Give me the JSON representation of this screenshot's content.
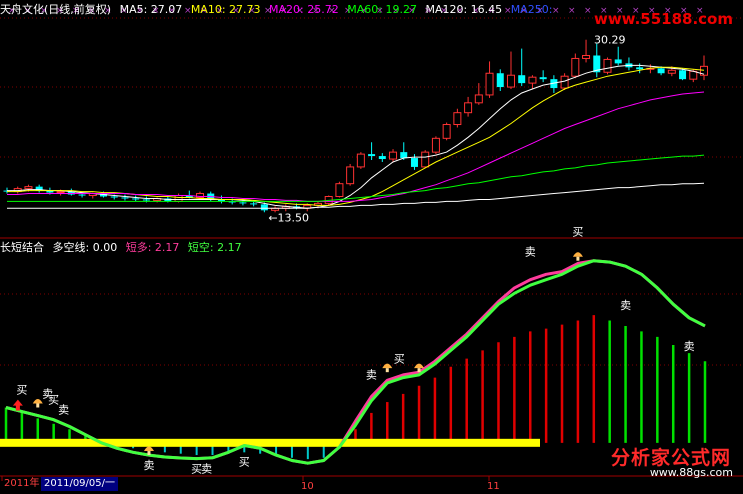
{
  "header_top": {
    "title": "天舟文化(日线,前复权)",
    "ma5": "MA5: 27.07",
    "ma10": "MA10: 27.73",
    "ma20": "MA20: 25.72",
    "ma60": "MA60: 19.27",
    "ma120": "MA120: 16.45",
    "ma250": "MA250: "
  },
  "header_bottom": {
    "title": "长短结合",
    "duokong": "多空线: 0.00",
    "duanduo": "短多: 2.17",
    "duankong": "短空: 2.17"
  },
  "watermark_top": "www.55188.com",
  "watermark_bottom": "分析家公式网",
  "watermark_bottom_url": "www.88gs.com",
  "date_axis": {
    "year_label": "2011年",
    "selected_date": "2011/09/05/一",
    "tick_labels": [
      "10",
      "11"
    ]
  },
  "colors": {
    "ma5": "#ffffff",
    "ma10": "#ffff00",
    "ma20": "#ff00ff",
    "ma60": "#00ff00",
    "ma120": "#ffffff",
    "up": "#ff3232",
    "down": "#00ffff",
    "duanduo": "#ff3c9c",
    "duankong": "#40ff40",
    "zero": "#ffff00"
  },
  "chart_data": [
    {
      "type": "candlestick",
      "title": "天舟文化(日线,前复权)",
      "annotations": [
        {
          "text": "30.29",
          "kind": "high"
        },
        {
          "text": "←13.50",
          "kind": "low"
        }
      ],
      "ylim": [
        11.5,
        33
      ],
      "candles": [
        {
          "o": 15.7,
          "h": 16.0,
          "l": 15.4,
          "c": 15.6
        },
        {
          "o": 15.6,
          "h": 16.1,
          "l": 15.4,
          "c": 15.9
        },
        {
          "o": 15.9,
          "h": 16.3,
          "l": 15.6,
          "c": 16.1
        },
        {
          "o": 16.1,
          "h": 16.3,
          "l": 15.5,
          "c": 15.7
        },
        {
          "o": 15.7,
          "h": 16.0,
          "l": 15.3,
          "c": 15.5
        },
        {
          "o": 15.5,
          "h": 15.8,
          "l": 15.2,
          "c": 15.6
        },
        {
          "o": 15.6,
          "h": 15.9,
          "l": 15.2,
          "c": 15.3
        },
        {
          "o": 15.3,
          "h": 15.6,
          "l": 15.0,
          "c": 15.2
        },
        {
          "o": 15.2,
          "h": 15.5,
          "l": 14.9,
          "c": 15.4
        },
        {
          "o": 15.4,
          "h": 15.6,
          "l": 15.0,
          "c": 15.1
        },
        {
          "o": 15.1,
          "h": 15.3,
          "l": 14.8,
          "c": 15.0
        },
        {
          "o": 15.0,
          "h": 15.3,
          "l": 14.7,
          "c": 14.9
        },
        {
          "o": 14.9,
          "h": 15.2,
          "l": 14.6,
          "c": 14.8
        },
        {
          "o": 14.8,
          "h": 15.1,
          "l": 14.5,
          "c": 14.7
        },
        {
          "o": 14.7,
          "h": 15.0,
          "l": 14.5,
          "c": 14.9
        },
        {
          "o": 14.9,
          "h": 15.1,
          "l": 14.5,
          "c": 14.6
        },
        {
          "o": 14.6,
          "h": 15.4,
          "l": 14.5,
          "c": 15.2
        },
        {
          "o": 15.2,
          "h": 15.7,
          "l": 14.9,
          "c": 15.0
        },
        {
          "o": 15.0,
          "h": 15.6,
          "l": 14.8,
          "c": 15.4
        },
        {
          "o": 15.4,
          "h": 15.6,
          "l": 14.6,
          "c": 14.8
        },
        {
          "o": 14.8,
          "h": 15.2,
          "l": 14.4,
          "c": 14.6
        },
        {
          "o": 14.6,
          "h": 14.9,
          "l": 14.3,
          "c": 14.5
        },
        {
          "o": 14.5,
          "h": 14.8,
          "l": 14.2,
          "c": 14.4
        },
        {
          "o": 14.4,
          "h": 14.7,
          "l": 14.1,
          "c": 14.3
        },
        {
          "o": 14.3,
          "h": 14.5,
          "l": 13.5,
          "c": 13.7
        },
        {
          "o": 13.7,
          "h": 14.1,
          "l": 13.5,
          "c": 13.9
        },
        {
          "o": 13.9,
          "h": 14.3,
          "l": 13.6,
          "c": 14.1
        },
        {
          "o": 14.1,
          "h": 14.4,
          "l": 13.8,
          "c": 13.9
        },
        {
          "o": 13.9,
          "h": 14.4,
          "l": 13.6,
          "c": 14.2
        },
        {
          "o": 14.2,
          "h": 14.6,
          "l": 13.9,
          "c": 14.4
        },
        {
          "o": 14.4,
          "h": 15.2,
          "l": 14.2,
          "c": 15.1
        },
        {
          "o": 15.1,
          "h": 16.6,
          "l": 15.0,
          "c": 16.4
        },
        {
          "o": 16.4,
          "h": 18.4,
          "l": 16.2,
          "c": 18.1
        },
        {
          "o": 18.1,
          "h": 19.6,
          "l": 17.9,
          "c": 19.4
        },
        {
          "o": 19.4,
          "h": 20.6,
          "l": 18.8,
          "c": 19.2
        },
        {
          "o": 19.2,
          "h": 19.5,
          "l": 18.6,
          "c": 18.9
        },
        {
          "o": 18.9,
          "h": 19.9,
          "l": 18.6,
          "c": 19.6
        },
        {
          "o": 19.6,
          "h": 20.6,
          "l": 18.8,
          "c": 19.0
        },
        {
          "o": 19.0,
          "h": 19.4,
          "l": 17.8,
          "c": 18.1
        },
        {
          "o": 18.1,
          "h": 19.8,
          "l": 18.0,
          "c": 19.6
        },
        {
          "o": 19.6,
          "h": 21.2,
          "l": 19.4,
          "c": 21.0
        },
        {
          "o": 21.0,
          "h": 22.6,
          "l": 20.8,
          "c": 22.4
        },
        {
          "o": 22.4,
          "h": 24.0,
          "l": 22.1,
          "c": 23.6
        },
        {
          "o": 23.6,
          "h": 25.2,
          "l": 23.2,
          "c": 24.6
        },
        {
          "o": 24.6,
          "h": 26.6,
          "l": 24.4,
          "c": 25.4
        },
        {
          "o": 25.4,
          "h": 28.8,
          "l": 25.1,
          "c": 27.6
        },
        {
          "o": 27.6,
          "h": 28.0,
          "l": 25.8,
          "c": 26.2
        },
        {
          "o": 26.2,
          "h": 29.8,
          "l": 26.0,
          "c": 27.4
        },
        {
          "o": 27.4,
          "h": 30.1,
          "l": 26.3,
          "c": 26.6
        },
        {
          "o": 26.6,
          "h": 27.4,
          "l": 26.0,
          "c": 27.2
        },
        {
          "o": 27.2,
          "h": 27.9,
          "l": 26.7,
          "c": 27.0
        },
        {
          "o": 27.0,
          "h": 27.4,
          "l": 25.6,
          "c": 26.1
        },
        {
          "o": 26.1,
          "h": 27.6,
          "l": 25.9,
          "c": 27.3
        },
        {
          "o": 27.3,
          "h": 29.6,
          "l": 27.1,
          "c": 29.1
        },
        {
          "o": 29.1,
          "h": 31.0,
          "l": 28.7,
          "c": 29.4
        },
        {
          "o": 29.4,
          "h": 30.6,
          "l": 27.2,
          "c": 27.7
        },
        {
          "o": 27.7,
          "h": 29.2,
          "l": 27.5,
          "c": 29.0
        },
        {
          "o": 29.0,
          "h": 30.29,
          "l": 28.4,
          "c": 28.6
        },
        {
          "o": 28.6,
          "h": 29.2,
          "l": 27.9,
          "c": 28.2
        },
        {
          "o": 28.2,
          "h": 28.6,
          "l": 27.6,
          "c": 28.0
        },
        {
          "o": 28.0,
          "h": 28.5,
          "l": 27.6,
          "c": 28.1
        },
        {
          "o": 28.1,
          "h": 28.3,
          "l": 27.4,
          "c": 27.6
        },
        {
          "o": 27.6,
          "h": 28.3,
          "l": 27.3,
          "c": 27.9
        },
        {
          "o": 27.9,
          "h": 28.1,
          "l": 26.9,
          "c": 27.0
        },
        {
          "o": 27.0,
          "h": 28.0,
          "l": 26.7,
          "c": 27.8
        },
        {
          "o": 27.4,
          "h": 29.4,
          "l": 26.9,
          "c": 28.3
        }
      ],
      "ma_lines": [
        {
          "name": "MA5",
          "values": [
            15.7,
            15.7,
            15.8,
            15.8,
            15.7,
            15.7,
            15.6,
            15.5,
            15.4,
            15.3,
            15.2,
            15.1,
            15.0,
            14.9,
            14.9,
            14.8,
            14.8,
            14.8,
            14.8,
            14.8,
            14.8,
            14.8,
            14.7,
            14.6,
            14.4,
            14.2,
            14.1,
            14.0,
            13.9,
            14.0,
            14.2,
            14.6,
            15.2,
            16.0,
            17.0,
            17.8,
            18.6,
            19.0,
            19.1,
            19.1,
            19.3,
            19.6,
            20.3,
            21.1,
            22.0,
            23.0,
            24.0,
            24.9,
            25.6,
            26.0,
            26.4,
            26.6,
            26.8,
            27.2,
            27.6,
            27.9,
            28.1,
            28.3,
            28.4,
            28.4,
            28.3,
            28.2,
            28.1,
            28.0,
            27.8,
            27.5
          ]
        },
        {
          "name": "MA10",
          "values": [
            15.6,
            15.6,
            15.7,
            15.7,
            15.7,
            15.7,
            15.7,
            15.6,
            15.6,
            15.5,
            15.5,
            15.4,
            15.3,
            15.2,
            15.1,
            15.1,
            15.0,
            15.0,
            14.9,
            14.9,
            14.8,
            14.8,
            14.8,
            14.7,
            14.6,
            14.5,
            14.4,
            14.3,
            14.3,
            14.2,
            14.2,
            14.3,
            14.5,
            14.8,
            15.1,
            15.6,
            16.2,
            16.8,
            17.4,
            18.0,
            18.6,
            19.1,
            19.6,
            20.1,
            20.6,
            21.1,
            21.8,
            22.5,
            23.3,
            24.1,
            24.8,
            25.4,
            26.0,
            26.4,
            26.7,
            27.0,
            27.3,
            27.5,
            27.7,
            27.9,
            28.1,
            28.2,
            28.2,
            28.1,
            28.0,
            27.9
          ]
        },
        {
          "name": "MA20",
          "values": [
            15.3,
            15.3,
            15.4,
            15.4,
            15.4,
            15.4,
            15.4,
            15.4,
            15.4,
            15.4,
            15.4,
            15.4,
            15.3,
            15.3,
            15.3,
            15.2,
            15.2,
            15.2,
            15.1,
            15.1,
            15.0,
            15.0,
            14.9,
            14.9,
            14.8,
            14.8,
            14.7,
            14.7,
            14.6,
            14.6,
            14.6,
            14.6,
            14.6,
            14.7,
            14.8,
            15.0,
            15.2,
            15.4,
            15.7,
            16.0,
            16.3,
            16.7,
            17.1,
            17.5,
            18.0,
            18.5,
            19.0,
            19.5,
            20.0,
            20.5,
            21.0,
            21.5,
            22.0,
            22.4,
            22.8,
            23.2,
            23.6,
            24.0,
            24.3,
            24.6,
            24.9,
            25.1,
            25.3,
            25.5,
            25.6,
            25.7
          ]
        },
        {
          "name": "MA60",
          "values": [
            14.6,
            14.6,
            14.6,
            14.6,
            14.6,
            14.6,
            14.6,
            14.6,
            14.6,
            14.6,
            14.6,
            14.6,
            14.6,
            14.6,
            14.6,
            14.6,
            14.6,
            14.6,
            14.6,
            14.6,
            14.6,
            14.6,
            14.6,
            14.6,
            14.6,
            14.6,
            14.6,
            14.6,
            14.6,
            14.6,
            14.7,
            14.8,
            14.9,
            15.0,
            15.1,
            15.2,
            15.3,
            15.5,
            15.6,
            15.7,
            15.9,
            16.0,
            16.2,
            16.4,
            16.5,
            16.7,
            16.9,
            17.1,
            17.2,
            17.4,
            17.6,
            17.7,
            17.9,
            18.0,
            18.2,
            18.3,
            18.5,
            18.6,
            18.7,
            18.8,
            18.9,
            19.0,
            19.1,
            19.2,
            19.2,
            19.3
          ]
        },
        {
          "name": "MA120",
          "values": [
            13.9,
            13.9,
            13.9,
            13.9,
            13.9,
            13.9,
            13.9,
            13.9,
            13.9,
            13.9,
            13.9,
            13.9,
            13.9,
            13.9,
            13.9,
            13.9,
            13.9,
            13.9,
            13.9,
            13.9,
            13.9,
            13.9,
            13.9,
            13.9,
            13.9,
            13.9,
            13.9,
            13.9,
            13.9,
            14.0,
            14.0,
            14.1,
            14.1,
            14.2,
            14.2,
            14.3,
            14.3,
            14.4,
            14.4,
            14.5,
            14.5,
            14.6,
            14.6,
            14.7,
            14.8,
            14.8,
            14.9,
            15.0,
            15.1,
            15.2,
            15.3,
            15.4,
            15.5,
            15.6,
            15.7,
            15.8,
            15.9,
            16.0,
            16.0,
            16.1,
            16.2,
            16.3,
            16.3,
            16.4,
            16.4,
            16.45
          ]
        }
      ]
    },
    {
      "type": "line",
      "title": "长短结合",
      "ylim": [
        -1.0,
        6.8
      ],
      "series": [
        {
          "name": "短多",
          "values": [
            1.3,
            1.15,
            1.0,
            0.85,
            0.6,
            0.3,
            0.0,
            -0.2,
            -0.35,
            -0.45,
            -0.52,
            -0.56,
            -0.58,
            -0.55,
            -0.35,
            -0.1,
            -0.2,
            -0.45,
            -0.65,
            -0.75,
            -0.65,
            -0.15,
            0.8,
            1.7,
            2.3,
            2.5,
            2.6,
            3.0,
            3.5,
            4.0,
            4.6,
            5.2,
            5.7,
            6.0,
            6.2,
            6.3,
            6.6,
            6.7,
            6.65,
            6.5,
            6.2,
            5.7,
            5.1,
            4.6,
            4.3
          ]
        },
        {
          "name": "短空",
          "values": [
            1.3,
            1.15,
            1.0,
            0.85,
            0.6,
            0.3,
            0.0,
            -0.2,
            -0.35,
            -0.45,
            -0.52,
            -0.56,
            -0.58,
            -0.55,
            -0.35,
            -0.1,
            -0.2,
            -0.45,
            -0.65,
            -0.75,
            -0.65,
            -0.15,
            0.65,
            1.55,
            2.2,
            2.4,
            2.5,
            2.9,
            3.4,
            3.9,
            4.5,
            5.1,
            5.5,
            5.8,
            6.0,
            6.2,
            6.5,
            6.7,
            6.65,
            6.5,
            6.2,
            5.7,
            5.1,
            4.6,
            4.3
          ]
        }
      ],
      "bar_values": [
        1.3,
        1.1,
        0.9,
        0.7,
        0.5,
        0.3,
        0.1,
        -0.1,
        -0.2,
        -0.3,
        -0.35,
        -0.4,
        -0.45,
        -0.45,
        -0.4,
        -0.35,
        -0.4,
        -0.5,
        -0.55,
        -0.6,
        -0.55,
        -0.2,
        0.5,
        1.1,
        1.5,
        1.8,
        2.1,
        2.4,
        2.8,
        3.1,
        3.4,
        3.7,
        3.9,
        4.1,
        4.2,
        4.35,
        4.5,
        4.7,
        4.5,
        4.3,
        4.1,
        3.9,
        3.6,
        3.3,
        3.0
      ],
      "signals": [
        {
          "text": "买"
        },
        {
          "text": "卖"
        },
        {
          "text": "买"
        },
        {
          "text": "卖"
        },
        {
          "text": "卖"
        },
        {
          "text": "买"
        },
        {
          "text": "卖"
        },
        {
          "text": "买"
        },
        {
          "text": "卖"
        },
        {
          "text": "买"
        },
        {
          "text": "卖"
        },
        {
          "text": "买"
        }
      ]
    }
  ]
}
